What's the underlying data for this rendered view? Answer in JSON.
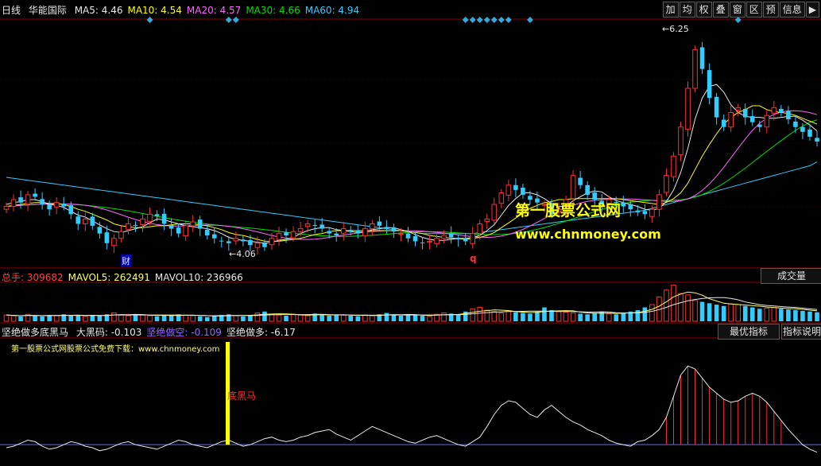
{
  "header": {
    "period": "日线",
    "stock": "华能国际",
    "ma": [
      {
        "label": "MA5:",
        "value": "4.46",
        "color": "#e8e8e8"
      },
      {
        "label": "MA10:",
        "value": "4.54",
        "color": "#ffff00"
      },
      {
        "label": "MA20:",
        "value": "4.57",
        "color": "#ff66ff"
      },
      {
        "label": "MA30:",
        "value": "4.66",
        "color": "#00e000"
      },
      {
        "label": "MA60:",
        "value": "4.94",
        "color": "#33ccff"
      }
    ],
    "toolbar": [
      "加",
      "均",
      "权",
      "叠",
      "窗",
      "区",
      "预",
      "信息",
      "▶"
    ]
  },
  "price_panel": {
    "high_label": "6.25",
    "low_label": "4.06",
    "cai_label": "财",
    "q_label": "q",
    "watermark_title": "第一股票公式网",
    "watermark_url": "www.chnmoney.com"
  },
  "volume_panel": {
    "items": [
      {
        "label": "总手:",
        "value": "309682",
        "color": "#ff4040"
      },
      {
        "label": "MAVOL5:",
        "value": "262491",
        "color": "#ffff66"
      },
      {
        "label": "MAVOL10:",
        "value": "236966",
        "color": "#e8e8e8"
      }
    ],
    "button": "成交量"
  },
  "indicator_panel": {
    "name": "坚绝做多底黑马",
    "items": [
      {
        "label": "大黑码:",
        "value": "-0.103",
        "color": "#e8e8e8"
      },
      {
        "label": "坚绝做空:",
        "value": "-0.109",
        "color": "#9966ff"
      },
      {
        "label": "坚绝做多:",
        "value": "-6.17",
        "color": "#e8e8e8"
      }
    ],
    "note": "第一股票公式网股票公式免费下载：www.chnmoney.com",
    "signal_label": "底黑马",
    "buttons": [
      "最优指标",
      "指标说明"
    ]
  },
  "chart_data": {
    "type": "candlestick",
    "title": "华能国际 日线",
    "series": [
      {
        "name": "MA5",
        "color": "#e8e8e8"
      },
      {
        "name": "MA10",
        "color": "#ffff00"
      },
      {
        "name": "MA20",
        "color": "#ff66ff"
      },
      {
        "name": "MA30",
        "color": "#00e000"
      },
      {
        "name": "MA60",
        "color": "#33ccff"
      }
    ],
    "price_close": [
      4.48,
      4.55,
      4.52,
      4.6,
      4.58,
      4.5,
      4.45,
      4.52,
      4.48,
      4.4,
      4.3,
      4.35,
      4.28,
      4.2,
      4.1,
      4.15,
      4.22,
      4.3,
      4.28,
      4.35,
      4.4,
      4.38,
      4.3,
      4.25,
      4.2,
      4.28,
      4.32,
      4.25,
      4.18,
      4.15,
      4.12,
      4.1,
      4.15,
      4.12,
      4.08,
      4.1,
      4.06,
      4.15,
      4.2,
      4.18,
      4.22,
      4.25,
      4.3,
      4.28,
      4.25,
      4.2,
      4.18,
      4.25,
      4.22,
      4.2,
      4.25,
      4.3,
      4.28,
      4.25,
      4.22,
      4.2,
      4.15,
      4.12,
      4.1,
      4.12,
      4.15,
      4.18,
      4.16,
      4.14,
      4.12,
      4.2,
      4.3,
      4.35,
      4.5,
      4.62,
      4.7,
      4.65,
      4.6,
      4.55,
      4.52,
      4.5,
      4.4,
      4.45,
      4.55,
      4.8,
      4.7,
      4.6,
      4.55,
      4.5,
      4.55,
      4.52,
      4.48,
      4.45,
      4.42,
      4.4,
      4.45,
      4.6,
      4.8,
      5.0,
      5.3,
      5.7,
      6.1,
      5.9,
      5.6,
      5.4,
      5.3,
      5.45,
      5.5,
      5.4,
      5.35,
      5.3,
      5.42,
      5.5,
      5.45,
      5.38,
      5.3,
      5.25,
      5.2,
      5.15
    ],
    "ma5": [
      4.5,
      4.52,
      4.53,
      4.55,
      4.55,
      4.53,
      4.5,
      4.49,
      4.47,
      4.43,
      4.39,
      4.37,
      4.33,
      4.29,
      4.25,
      4.22,
      4.21,
      4.23,
      4.25,
      4.27,
      4.31,
      4.35,
      4.34,
      4.32,
      4.3,
      4.28,
      4.27,
      4.26,
      4.25,
      4.23,
      4.2,
      4.16,
      4.14,
      4.13,
      4.12,
      4.11,
      4.1,
      4.11,
      4.13,
      4.14,
      4.16,
      4.2,
      4.23,
      4.25,
      4.26,
      4.26,
      4.24,
      4.23,
      4.22,
      4.21,
      4.22,
      4.24,
      4.25,
      4.26,
      4.26,
      4.24,
      4.22,
      4.19,
      4.16,
      4.14,
      4.13,
      4.13,
      4.14,
      4.15,
      4.15,
      4.16,
      4.18,
      4.23,
      4.29,
      4.39,
      4.49,
      4.56,
      4.62,
      4.62,
      4.6,
      4.56,
      4.51,
      4.48,
      4.48,
      4.54,
      4.58,
      4.62,
      4.64,
      4.63,
      4.58,
      4.54,
      4.52,
      4.5,
      4.48,
      4.45,
      4.44,
      4.46,
      4.53,
      4.65,
      4.83,
      5.08,
      5.38,
      5.6,
      5.72,
      5.74,
      5.66,
      5.53,
      5.45,
      5.41,
      5.4,
      5.4,
      5.39,
      5.39,
      5.4,
      5.41,
      5.41,
      5.37,
      5.32,
      5.26
    ],
    "ma10": [
      4.48,
      4.49,
      4.5,
      4.51,
      4.52,
      4.52,
      4.51,
      4.51,
      4.5,
      4.48,
      4.45,
      4.43,
      4.4,
      4.37,
      4.34,
      4.3,
      4.28,
      4.27,
      4.26,
      4.26,
      4.27,
      4.28,
      4.28,
      4.29,
      4.3,
      4.3,
      4.3,
      4.29,
      4.28,
      4.26,
      4.24,
      4.21,
      4.19,
      4.18,
      4.16,
      4.14,
      4.12,
      4.12,
      4.12,
      4.13,
      4.14,
      4.15,
      4.17,
      4.19,
      4.2,
      4.22,
      4.23,
      4.23,
      4.23,
      4.23,
      4.23,
      4.23,
      4.23,
      4.23,
      4.23,
      4.23,
      4.22,
      4.21,
      4.2,
      4.18,
      4.17,
      4.16,
      4.15,
      4.15,
      4.14,
      4.15,
      4.16,
      4.18,
      4.21,
      4.26,
      4.31,
      4.36,
      4.41,
      4.46,
      4.49,
      4.52,
      4.53,
      4.55,
      4.55,
      4.56,
      4.56,
      4.56,
      4.56,
      4.56,
      4.56,
      4.56,
      4.55,
      4.54,
      4.53,
      4.52,
      4.51,
      4.5,
      4.52,
      4.56,
      4.62,
      4.72,
      4.86,
      5.0,
      5.12,
      5.23,
      5.33,
      5.4,
      5.45,
      5.48,
      5.52,
      5.52,
      5.48,
      5.46,
      5.45,
      5.44,
      5.42,
      5.39,
      5.36,
      5.33
    ],
    "ma60": [
      4.78,
      4.77,
      4.76,
      4.75,
      4.74,
      4.73,
      4.72,
      4.71,
      4.7,
      4.69,
      4.68,
      4.67,
      4.66,
      4.65,
      4.64,
      4.63,
      4.62,
      4.61,
      4.6,
      4.59,
      4.58,
      4.57,
      4.56,
      4.55,
      4.54,
      4.53,
      4.52,
      4.51,
      4.5,
      4.49,
      4.48,
      4.47,
      4.46,
      4.45,
      4.44,
      4.43,
      4.42,
      4.41,
      4.4,
      4.39,
      4.38,
      4.37,
      4.36,
      4.35,
      4.34,
      4.33,
      4.32,
      4.31,
      4.3,
      4.29,
      4.28,
      4.27,
      4.26,
      4.25,
      4.24,
      4.23,
      4.22,
      4.21,
      4.2,
      4.2,
      4.2,
      4.2,
      4.2,
      4.2,
      4.2,
      4.2,
      4.21,
      4.22,
      4.23,
      4.24,
      4.25,
      4.26,
      4.27,
      4.28,
      4.29,
      4.3,
      4.31,
      4.32,
      4.33,
      4.34,
      4.35,
      4.36,
      4.37,
      4.38,
      4.39,
      4.4,
      4.41,
      4.42,
      4.43,
      4.44,
      4.46,
      4.48,
      4.5,
      4.52,
      4.54,
      4.56,
      4.58,
      4.6,
      4.62,
      4.64,
      4.66,
      4.68,
      4.7,
      4.72,
      4.74,
      4.76,
      4.78,
      4.8,
      4.82,
      4.84,
      4.86,
      4.88,
      4.9,
      4.94
    ],
    "volume": [
      9,
      8,
      7,
      10,
      8,
      7,
      9,
      8,
      10,
      9,
      8,
      7,
      9,
      8,
      10,
      12,
      9,
      8,
      10,
      9,
      8,
      7,
      9,
      8,
      10,
      9,
      8,
      7,
      6,
      8,
      9,
      10,
      8,
      7,
      9,
      12,
      14,
      10,
      9,
      8,
      10,
      9,
      8,
      11,
      9,
      8,
      10,
      9,
      8,
      7,
      9,
      8,
      10,
      12,
      9,
      8,
      10,
      9,
      8,
      7,
      10,
      12,
      11,
      9,
      14,
      18,
      20,
      16,
      14,
      12,
      15,
      13,
      12,
      11,
      14,
      20,
      16,
      14,
      13,
      12,
      11,
      10,
      12,
      14,
      11,
      10,
      12,
      14,
      16,
      20,
      24,
      35,
      45,
      52,
      40,
      38,
      30,
      28,
      26,
      24,
      22,
      25,
      24,
      22,
      20,
      18,
      19,
      20,
      18,
      17,
      16,
      15,
      14,
      13
    ],
    "indicator": [
      -0.2,
      -0.1,
      0.1,
      0.3,
      0.2,
      -0.1,
      -0.3,
      -0.2,
      0.0,
      0.2,
      0.1,
      -0.1,
      -0.2,
      -0.4,
      -0.3,
      -0.1,
      0.1,
      0.2,
      0.0,
      -0.1,
      -0.2,
      -0.3,
      -0.1,
      0.1,
      0.3,
      0.2,
      0.0,
      -0.1,
      -0.2,
      0.0,
      0.2,
      0.3,
      0.1,
      -0.1,
      0.0,
      0.2,
      0.4,
      0.5,
      0.3,
      0.2,
      0.3,
      0.5,
      0.6,
      0.8,
      0.9,
      1.0,
      0.7,
      0.5,
      0.3,
      0.6,
      0.9,
      1.2,
      1.0,
      0.8,
      0.6,
      0.4,
      0.2,
      0.1,
      0.3,
      0.5,
      0.6,
      0.4,
      0.2,
      0.0,
      -0.1,
      0.2,
      0.5,
      1.2,
      2.0,
      2.6,
      2.9,
      2.8,
      2.4,
      2.0,
      1.8,
      2.3,
      2.6,
      2.2,
      1.8,
      1.5,
      1.3,
      1.0,
      0.8,
      0.6,
      0.3,
      0.1,
      0.0,
      -0.1,
      0.2,
      0.3,
      0.6,
      1.0,
      1.8,
      3.2,
      4.6,
      5.2,
      5.0,
      4.4,
      3.8,
      3.4,
      3.0,
      2.8,
      2.9,
      3.2,
      3.4,
      3.2,
      2.8,
      2.2,
      1.6,
      1.0,
      0.5,
      0.0,
      -0.3,
      -0.5
    ],
    "high": 6.25,
    "low": 4.06
  }
}
